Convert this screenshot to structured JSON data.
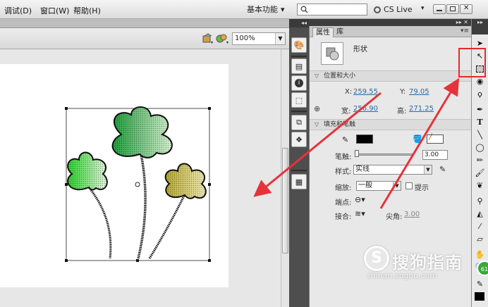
{
  "menu": {
    "items": [
      "调试(D)",
      "窗口(W)",
      "帮助(H)"
    ],
    "workspace": "基本功能",
    "cs_live": "CS Live"
  },
  "edit_bar": {
    "zoom": "100%"
  },
  "panel": {
    "tabs": [
      "属性",
      "库"
    ],
    "object_type": "形状",
    "position_section": "位置和大小",
    "x_label": "X:",
    "x_value": "259.55",
    "y_label": "Y:",
    "y_value": "79.05",
    "width_label": "宽:",
    "width_value": "256.90",
    "height_label": "高:",
    "height_value": "271.25",
    "fill_stroke_section": "填充和笔触",
    "stroke_label": "笔触:",
    "stroke_value": "3.00",
    "style_label": "样式:",
    "style_value": "实线",
    "scale_label": "缩放:",
    "scale_value": "一般",
    "hint_label": "提示",
    "cap_label": "端点:",
    "join_label": "接合:",
    "miter_label": "尖角:",
    "miter_value": "3.00",
    "stroke_color": "#000000"
  },
  "tools": [
    "selection-tool",
    "subselection-tool",
    "free-transform-tool",
    "3d-rotation-tool",
    "lasso-tool",
    "pen-tool",
    "text-tool",
    "line-tool",
    "rectangle-tool",
    "pencil-tool",
    "brush-tool",
    "deco-tool",
    "bone-tool",
    "paint-bucket-tool",
    "eyedropper-tool",
    "eraser-tool",
    "hand-tool",
    "zoom-tool"
  ],
  "watermark": {
    "text": "搜狗指南",
    "url": "zhinan.sogou.com"
  },
  "badge": "61",
  "colors": {
    "highlight": "#e32a2a",
    "accent_link": "#2a6aa8",
    "leaf_green": "#2db34a",
    "leaf_yellow": "#c8c040"
  }
}
